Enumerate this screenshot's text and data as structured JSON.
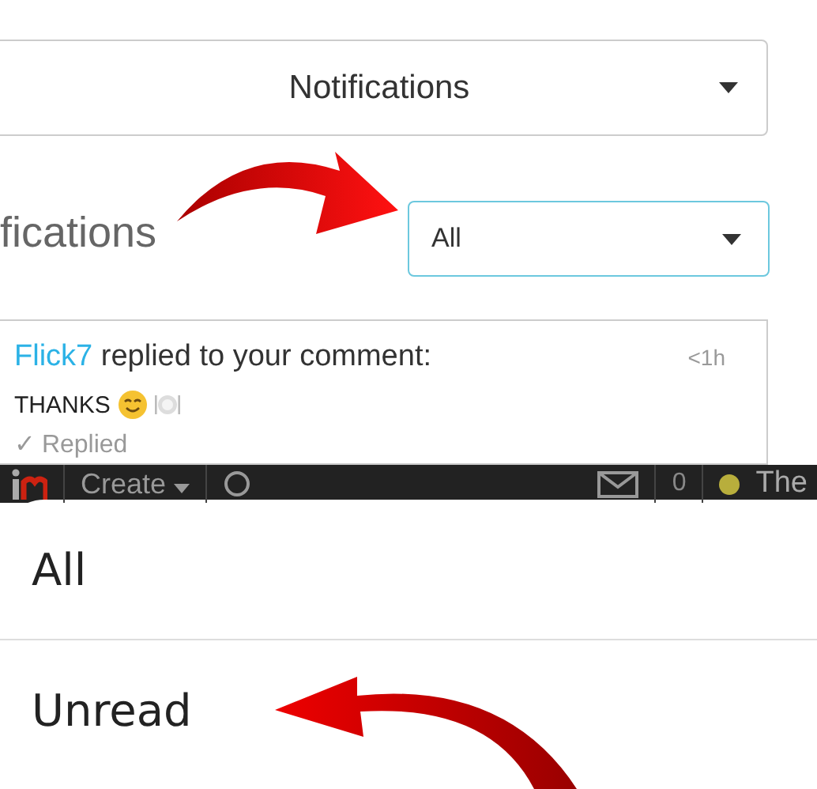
{
  "notifications_dropdown": {
    "value": "Notifications"
  },
  "heading": "fications",
  "filter_dropdown": {
    "value": "All"
  },
  "notification": {
    "user": "Flick7",
    "text": "replied to your comment:",
    "time": "<1h",
    "message": "THANKS",
    "status": "✓ Replied"
  },
  "navbar": {
    "create": "Create",
    "count": "0",
    "user": "The"
  },
  "menu": {
    "options": [
      {
        "label": "All"
      },
      {
        "label": "Unread"
      }
    ]
  }
}
